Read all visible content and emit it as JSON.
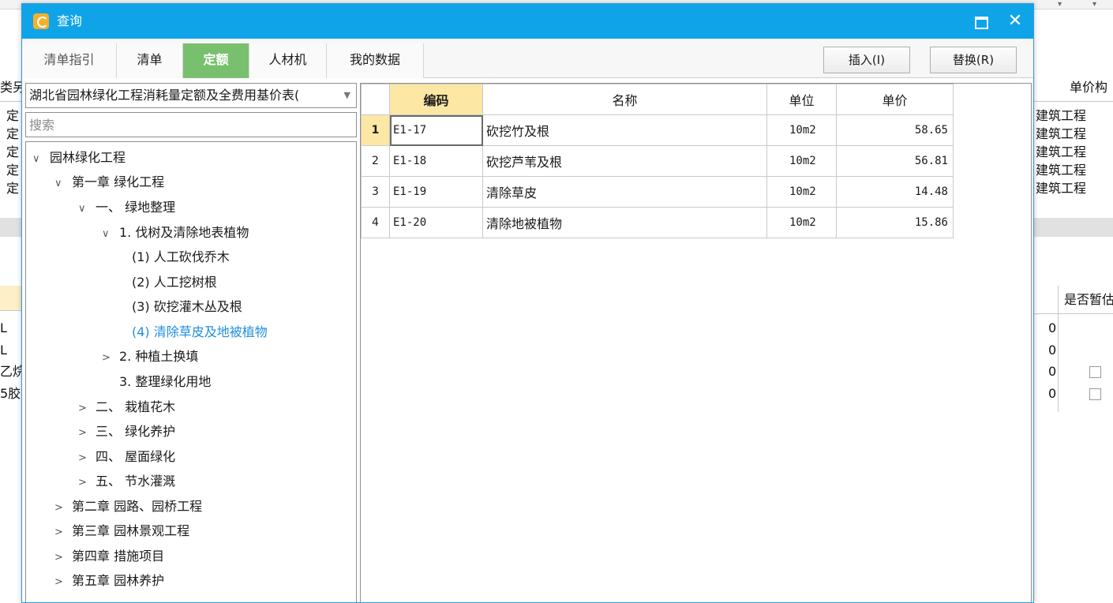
{
  "background": {
    "left_header": "类另",
    "left_rows": [
      "定",
      "定",
      "定",
      "定",
      "定"
    ],
    "left_lower_rows": [
      "L",
      "L",
      "乙烷",
      "5胶"
    ],
    "right_header": "单价构",
    "right_rows": [
      "建筑工程",
      "建筑工程",
      "建筑工程",
      "建筑工程",
      "建筑工程"
    ],
    "right_lower_header": "是否暂估",
    "right_lower_values": [
      "0",
      "0",
      "0",
      "0"
    ],
    "dropdown_glyph": "▾"
  },
  "dialog": {
    "title": "查询",
    "tabs": [
      "清单指引",
      "清单",
      "定额",
      "人材机",
      "我的数据"
    ],
    "active_tab": "定额",
    "insert_label": "插入(I)",
    "replace_label": "替换(R)",
    "library_select": "湖北省园林绿化工程消耗量定额及全费用基价表(",
    "search_placeholder": "搜索",
    "tree": [
      {
        "arrow": "∨",
        "label": "园林绿化工程"
      },
      {
        "arrow": "∨",
        "label": "第一章 绿化工程"
      },
      {
        "arrow": "∨",
        "label": "一、 绿地整理"
      },
      {
        "arrow": "∨",
        "label": "1. 伐树及清除地表植物"
      },
      {
        "arrow": "",
        "label": "(1) 人工砍伐乔木"
      },
      {
        "arrow": "",
        "label": "(2) 人工挖树根"
      },
      {
        "arrow": "",
        "label": "(3) 砍挖灌木丛及根"
      },
      {
        "arrow": "",
        "label": "(4) 清除草皮及地被植物"
      },
      {
        "arrow": ">",
        "label": "2. 种植土换填"
      },
      {
        "arrow": "",
        "label": "3. 整理绿化用地"
      },
      {
        "arrow": ">",
        "label": "二、 栽植花木"
      },
      {
        "arrow": ">",
        "label": "三、 绿化养护"
      },
      {
        "arrow": ">",
        "label": "四、 屋面绿化"
      },
      {
        "arrow": ">",
        "label": "五、 节水灌溉"
      },
      {
        "arrow": ">",
        "label": "第二章 园路、园桥工程"
      },
      {
        "arrow": ">",
        "label": "第三章 园林景观工程"
      },
      {
        "arrow": ">",
        "label": "第四章 措施项目"
      },
      {
        "arrow": ">",
        "label": "第五章 园林养护"
      }
    ],
    "grid": {
      "columns": [
        "编码",
        "名称",
        "单位",
        "单价"
      ],
      "rows": [
        {
          "no": "1",
          "code": "E1-17",
          "name": "砍挖竹及根",
          "unit": "10m2",
          "price": "58.65"
        },
        {
          "no": "2",
          "code": "E1-18",
          "name": "砍挖芦苇及根",
          "unit": "10m2",
          "price": "56.81"
        },
        {
          "no": "3",
          "code": "E1-19",
          "name": "清除草皮",
          "unit": "10m2",
          "price": "14.48"
        },
        {
          "no": "4",
          "code": "E1-20",
          "name": "清除地被植物",
          "unit": "10m2",
          "price": "15.86"
        }
      ]
    }
  },
  "colors": {
    "titlebar": "#0fa4e8",
    "active_tab": "#78c06e",
    "selection_highlight": "#fde7a4",
    "tree_selected": "#1f8fe0"
  }
}
